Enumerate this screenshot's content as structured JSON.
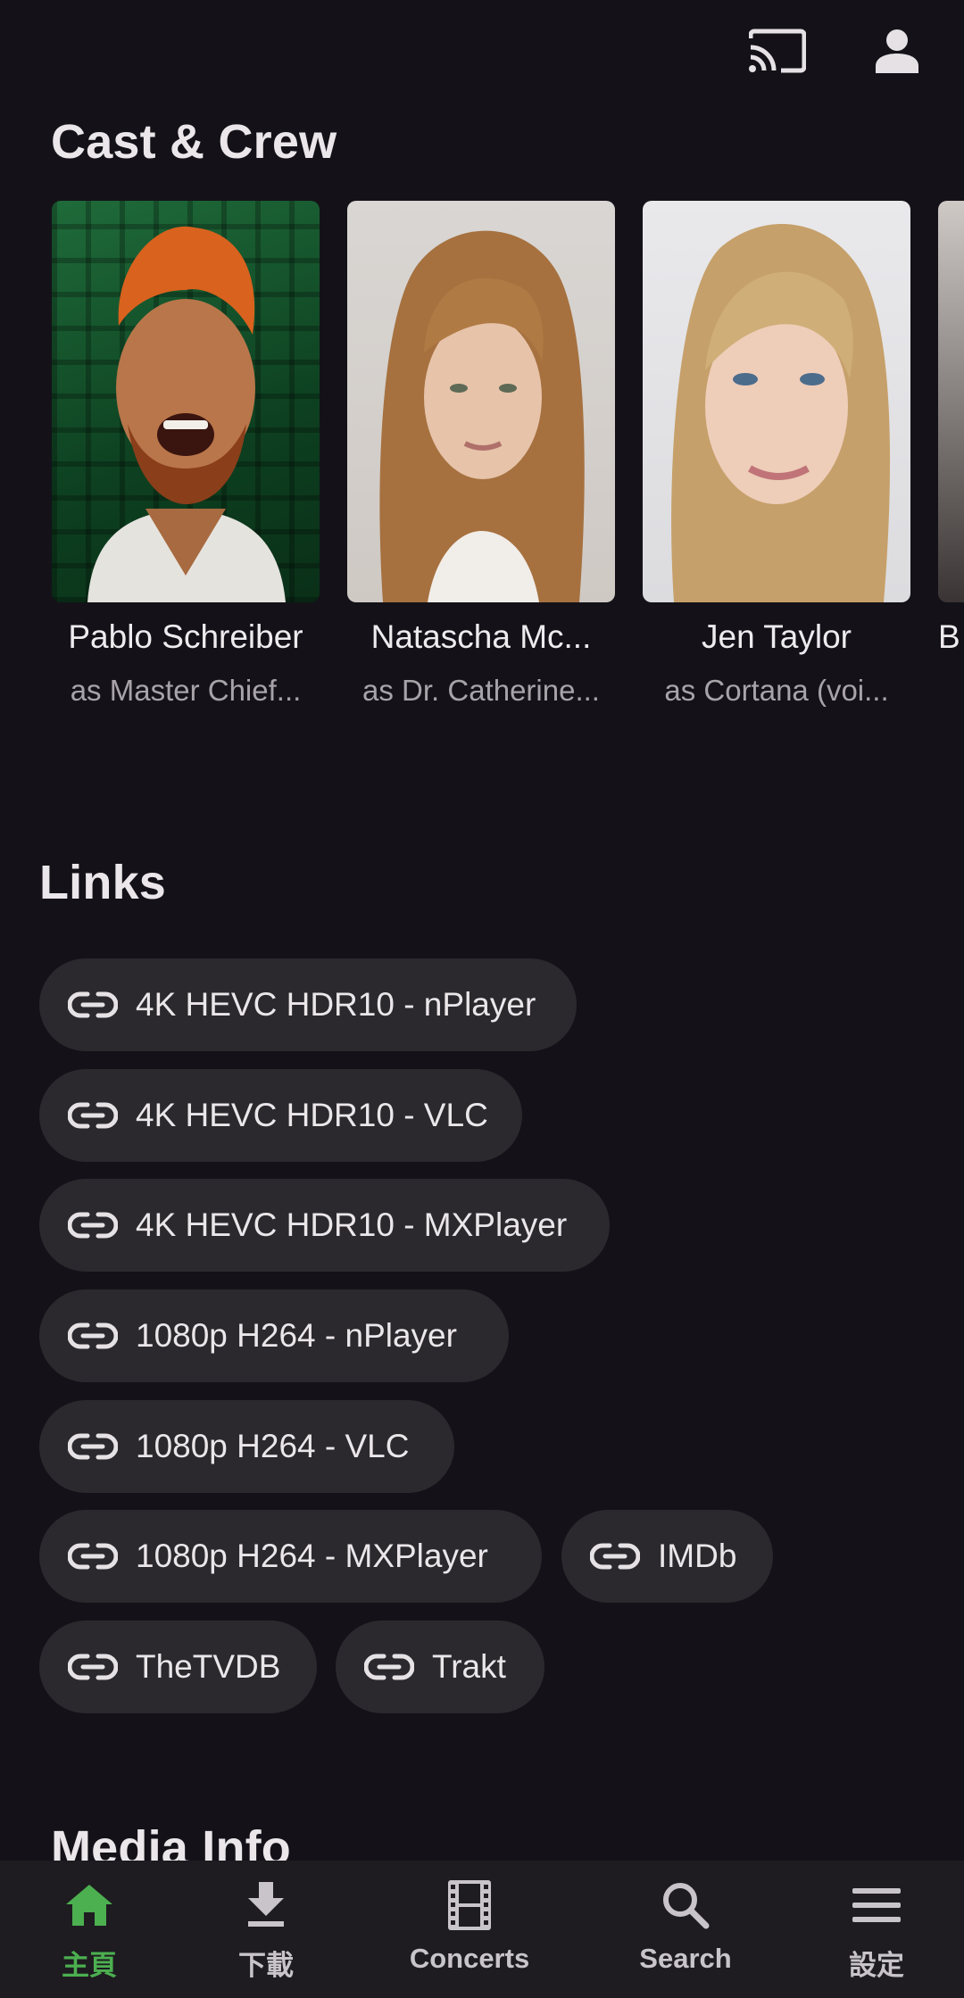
{
  "topbar": {
    "cast_icon": "cast-icon",
    "account_icon": "account-icon"
  },
  "cast_section": {
    "title": "Cast & Crew",
    "members": [
      {
        "name": "Pablo Schreiber",
        "role": "as Master Chief..."
      },
      {
        "name": "Natascha Mc...",
        "role": "as Dr. Catherine..."
      },
      {
        "name": "Jen Taylor",
        "role": "as Cortana (voi..."
      },
      {
        "name": "B",
        "role": ""
      }
    ]
  },
  "links_section": {
    "title": "Links",
    "links": [
      {
        "label": "4K HEVC HDR10 - nPlayer"
      },
      {
        "label": "4K HEVC HDR10 - VLC"
      },
      {
        "label": "4K HEVC HDR10 - MXPlayer"
      },
      {
        "label": "1080p H264 - nPlayer"
      },
      {
        "label": "1080p H264 - VLC"
      },
      {
        "label": "1080p H264 - MXPlayer"
      },
      {
        "label": "IMDb"
      },
      {
        "label": "TheTVDB"
      },
      {
        "label": "Trakt"
      }
    ]
  },
  "media_section": {
    "title": "Media Info"
  },
  "bottom_nav": {
    "accent": "#4caf50",
    "items": [
      {
        "label": "主頁",
        "icon": "home-icon",
        "active": true
      },
      {
        "label": "下載",
        "icon": "download-icon",
        "active": false
      },
      {
        "label": "Concerts",
        "icon": "film-icon",
        "active": false
      },
      {
        "label": "Search",
        "icon": "search-icon",
        "active": false
      },
      {
        "label": "設定",
        "icon": "menu-icon",
        "active": false
      }
    ]
  }
}
